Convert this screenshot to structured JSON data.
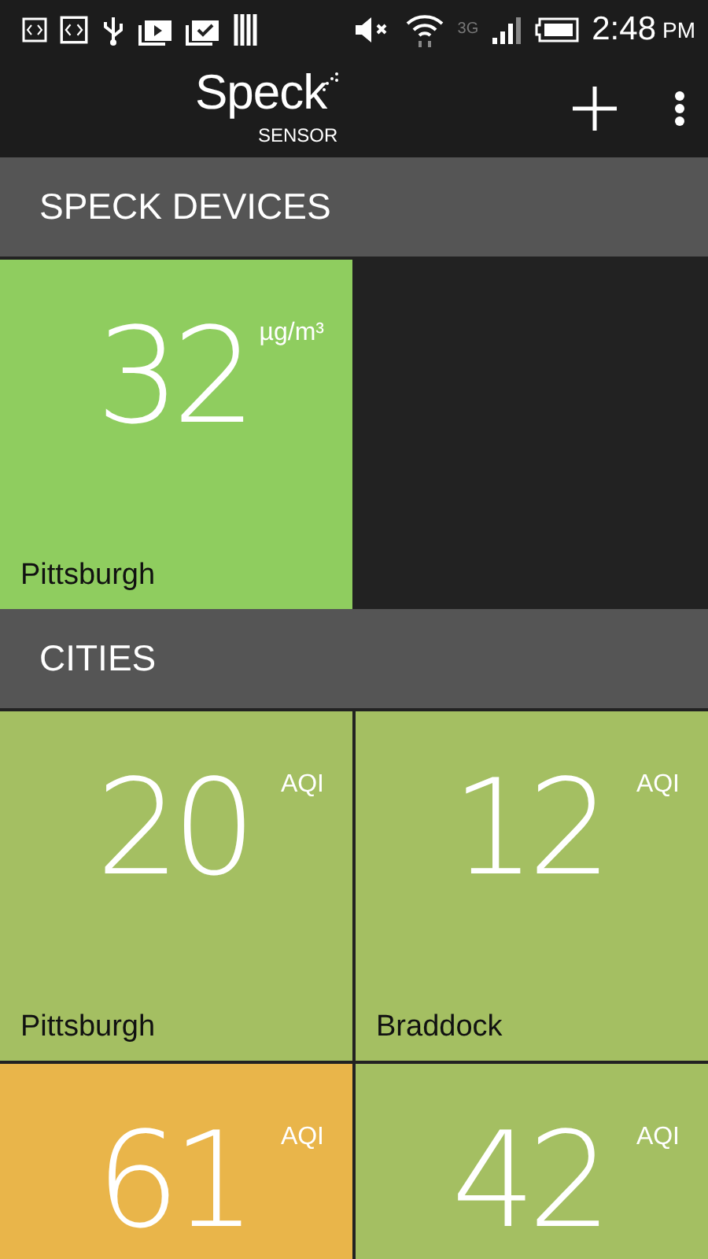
{
  "status_bar": {
    "network": "3G",
    "time": "2:48",
    "meridiem": "PM"
  },
  "app_bar": {
    "logo_title": "Speck",
    "logo_subtitle": "SENSOR"
  },
  "sections": [
    {
      "title": "SPECK DEVICES",
      "tiles": [
        {
          "value": "32",
          "unit": "µg/m³",
          "name": "Pittsburgh",
          "color": "#8fcd5f"
        }
      ]
    },
    {
      "title": "CITIES",
      "tiles": [
        {
          "value": "20",
          "unit": "AQI",
          "name": "Pittsburgh",
          "color": "#a4bf62"
        },
        {
          "value": "12",
          "unit": "AQI",
          "name": "Braddock",
          "color": "#a4bf62"
        },
        {
          "value": "61",
          "unit": "AQI",
          "color": "#e9b54a"
        },
        {
          "value": "42",
          "unit": "AQI",
          "color": "#a4bf62"
        }
      ]
    }
  ]
}
